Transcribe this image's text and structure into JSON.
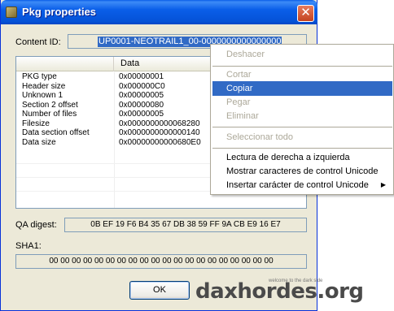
{
  "window": {
    "title": "Pkg properties",
    "close_label": "✕"
  },
  "content_id": {
    "label": "Content ID:",
    "value": "UP0001-NEOTRAIL1_00-0000000000000000"
  },
  "list": {
    "columns": [
      "",
      "Data"
    ],
    "rows": [
      {
        "key": "PKG type",
        "value": "0x00000001"
      },
      {
        "key": "Header size",
        "value": "0x000000C0"
      },
      {
        "key": "Unknown 1",
        "value": "0x00000005"
      },
      {
        "key": "Section 2 offset",
        "value": "0x00000080"
      },
      {
        "key": "Number of files",
        "value": "0x00000005"
      },
      {
        "key": "Filesize",
        "value": "0x0000000000068280"
      },
      {
        "key": "Data section offset",
        "value": "0x0000000000000140"
      },
      {
        "key": "Data size",
        "value": "0x00000000000680E0"
      }
    ]
  },
  "qa_digest": {
    "label": "QA digest:",
    "value": "0B EF 19 F6 B4 35 67 DB 38 59 FF 9A CB E9 16 E7"
  },
  "sha1": {
    "label": "SHA1:",
    "value": "00 00 00 00 00 00 00 00 00 00 00 00 00 00 00 00 00 00 00 00"
  },
  "ok_label": "OK",
  "context_menu": {
    "items": [
      {
        "label": "Deshacer",
        "disabled": true
      },
      {
        "label": "Cortar",
        "disabled": true
      },
      {
        "label": "Copiar",
        "disabled": false,
        "selected": true
      },
      {
        "label": "Pegar",
        "disabled": true
      },
      {
        "label": "Eliminar",
        "disabled": true
      },
      {
        "label": "Seleccionar todo",
        "disabled": true
      },
      {
        "label": "Lectura de derecha a izquierda",
        "disabled": false
      },
      {
        "label": "Mostrar caracteres de control Unicode",
        "disabled": false
      },
      {
        "label": "Insertar carácter de control Unicode",
        "disabled": false,
        "submenu": true
      }
    ]
  },
  "watermark": {
    "text": "daxhordes.org",
    "tagline": "welcome to the dark side"
  },
  "colors": {
    "titlebar": "#0a5ee8",
    "selection": "#316ac5",
    "dialog_bg": "#ece9d8"
  }
}
